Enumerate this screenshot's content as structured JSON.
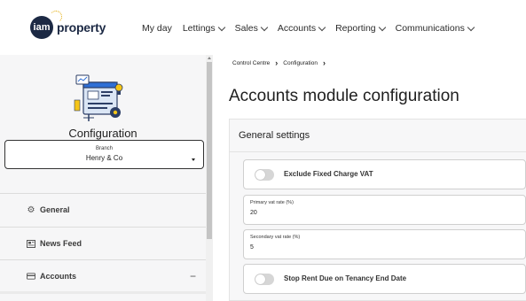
{
  "header": {
    "logo_circle_text": "iam",
    "logo_word": "property",
    "nav": [
      {
        "label": "My day",
        "has_dropdown": false
      },
      {
        "label": "Lettings",
        "has_dropdown": true
      },
      {
        "label": "Sales",
        "has_dropdown": true
      },
      {
        "label": "Accounts",
        "has_dropdown": true
      },
      {
        "label": "Reporting",
        "has_dropdown": true
      },
      {
        "label": "Communications",
        "has_dropdown": true
      }
    ]
  },
  "sidebar": {
    "title": "Configuration",
    "branch": {
      "label": "Branch",
      "value": "Henry & Co"
    },
    "items": [
      {
        "label": "General",
        "icon": "gear-icon"
      },
      {
        "label": "News Feed",
        "icon": "newspaper-icon"
      },
      {
        "label": "Accounts",
        "icon": "credit-card-icon",
        "expanded": true,
        "toggle_symbol": "−"
      }
    ]
  },
  "breadcrumb": [
    "Control Centre",
    "Configuration"
  ],
  "breadcrumb_separator": "›",
  "page_title": "Accounts module configuration",
  "settings": {
    "title": "General settings",
    "exclude_fixed_charge_vat": {
      "label": "Exclude Fixed Charge VAT",
      "enabled": false
    },
    "primary_vat_rate": {
      "label": "Primary vat rate (%)",
      "value": "20"
    },
    "secondary_vat_rate": {
      "label": "Secondary vat rate (%)",
      "value": "5"
    },
    "stop_rent_due": {
      "label": "Stop Rent Due on Tenancy End Date",
      "enabled": false
    }
  },
  "colors": {
    "brand_navy": "#1c2944",
    "brand_accent": "#e2a900",
    "toggle_off": "#d6d6d6"
  }
}
